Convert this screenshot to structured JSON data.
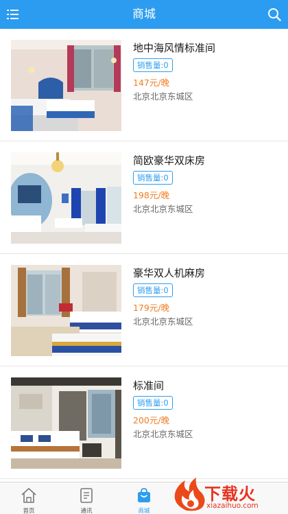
{
  "header": {
    "title": "商城",
    "menu_icon": "menu-icon",
    "search_icon": "search-icon",
    "bg_color": "#2c9cf0"
  },
  "products": [
    {
      "name": "地中海风情标准间",
      "sales": "销售量:0",
      "price": "147元/晚",
      "address": "北京北京东城区"
    },
    {
      "name": "简欧豪华双床房",
      "sales": "销售量:0",
      "price": "198元/晚",
      "address": "北京北京东城区"
    },
    {
      "name": "豪华双人机麻房",
      "sales": "销售量:0",
      "price": "179元/晚",
      "address": "北京北京东城区"
    },
    {
      "name": "标准间",
      "sales": "销售量:0",
      "price": "200元/晚",
      "address": "北京北京东城区"
    }
  ],
  "tabs": [
    {
      "label": "首页",
      "icon": "home-icon"
    },
    {
      "label": "通讯",
      "icon": "contacts-icon"
    },
    {
      "label": "商城",
      "icon": "shopping-bag-icon",
      "active": true
    }
  ],
  "watermark": {
    "text": "下载火",
    "url": "xiazaihuo.com"
  },
  "colors": {
    "accent": "#2c9cf0",
    "price": "#ef7d22",
    "watermark": "#e8311e"
  }
}
